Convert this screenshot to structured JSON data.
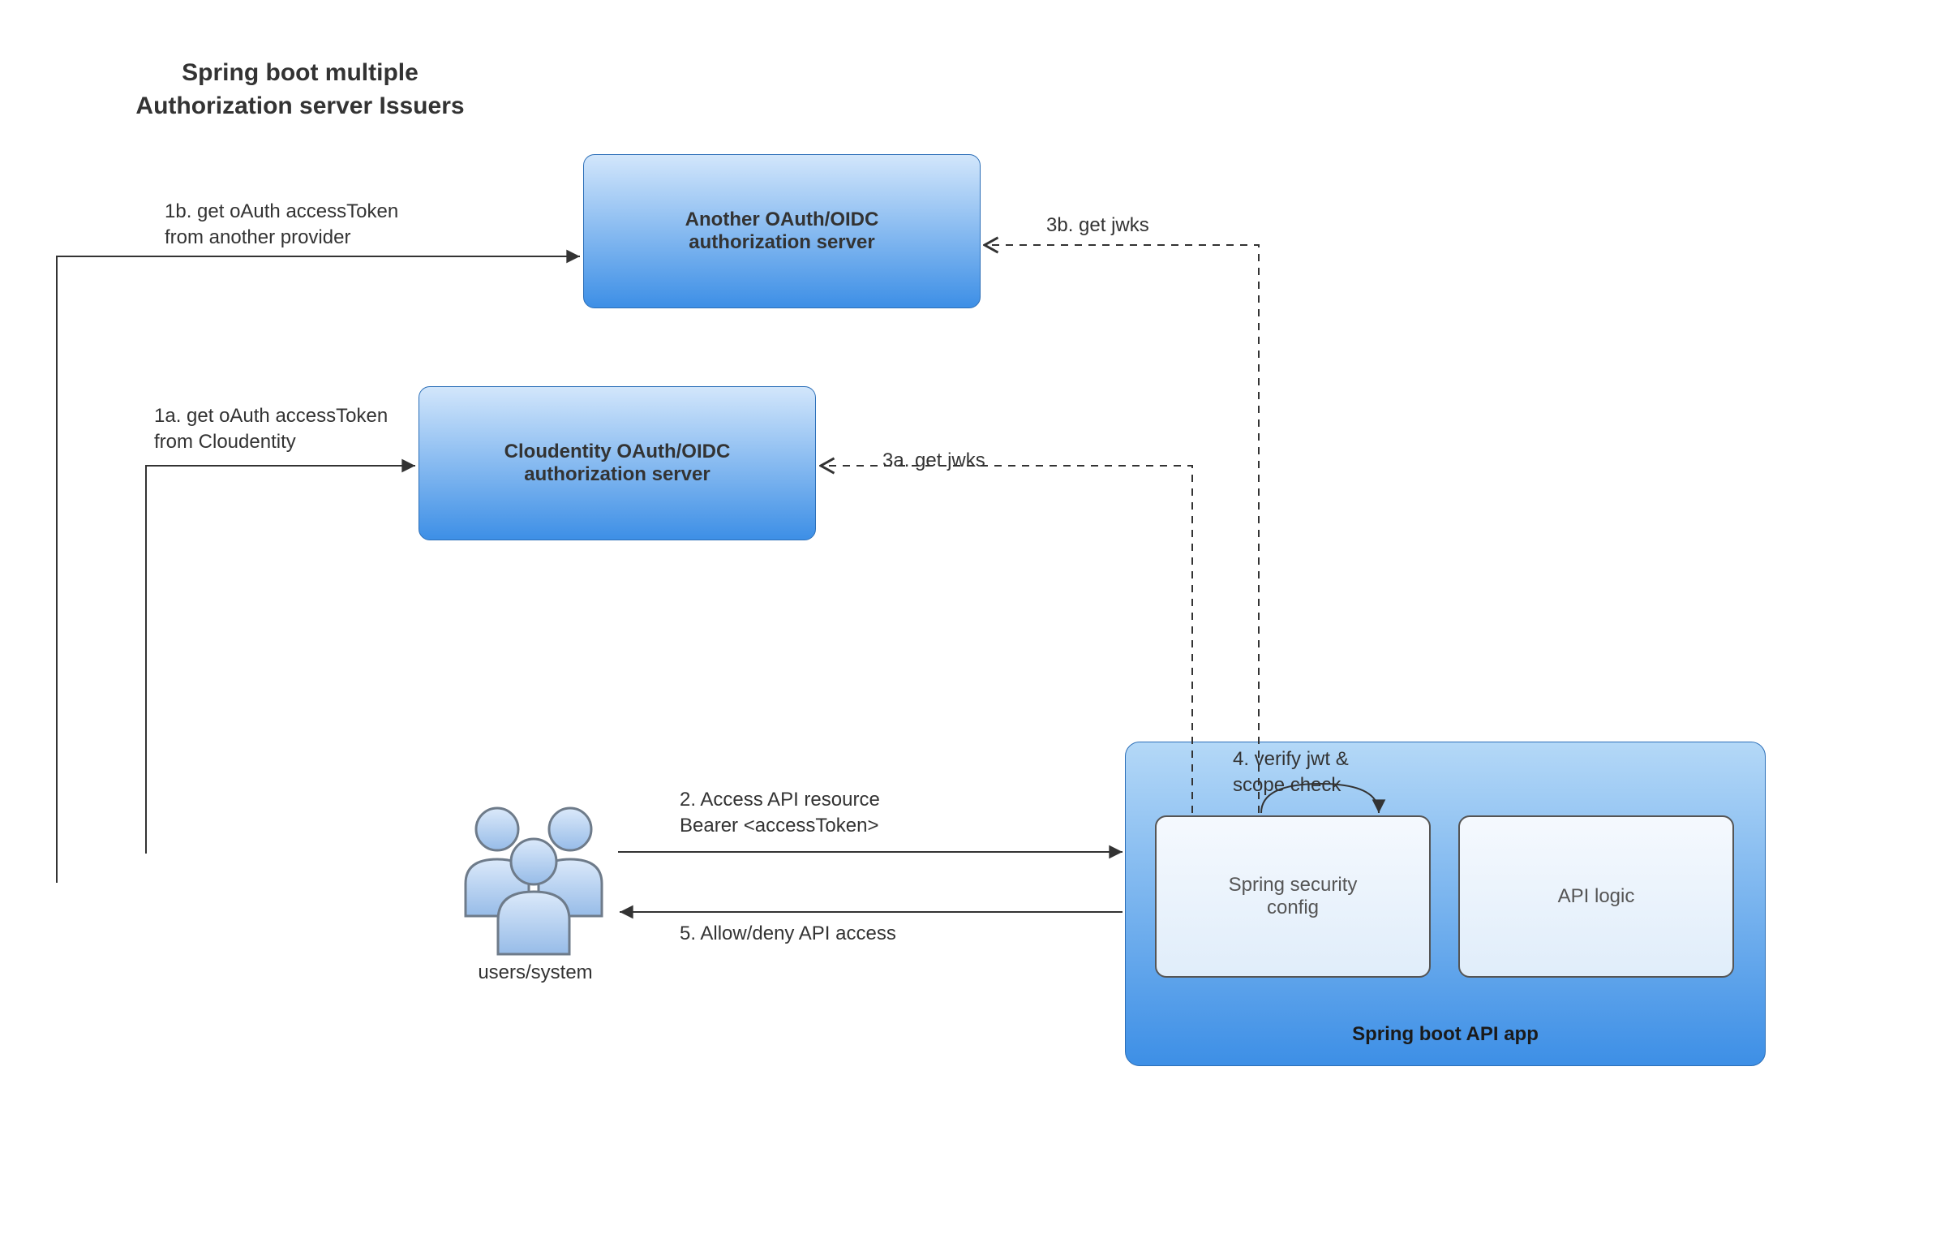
{
  "title": "Spring boot multiple\nAuthorization server Issuers",
  "nodes": {
    "another_server": "Another OAuth/OIDC\nauthorization server",
    "cloudentity_server": "Cloudentity OAuth/OIDC\nauthorization server",
    "spring_security": "Spring security\nconfig",
    "api_logic": "API logic",
    "container": "Spring boot API app",
    "users": "users/system"
  },
  "edges": {
    "e1a": "1a. get oAuth accessToken\nfrom Cloudentity",
    "e1b": "1b. get oAuth accessToken\nfrom another provider",
    "e2": "2. Access API resource\nBearer <accessToken>",
    "e3a": "3a. get jwks",
    "e3b": "3b. get jwks",
    "e4": "4. verify jwt &\nscope check",
    "e5": "5. Allow/deny API access"
  }
}
